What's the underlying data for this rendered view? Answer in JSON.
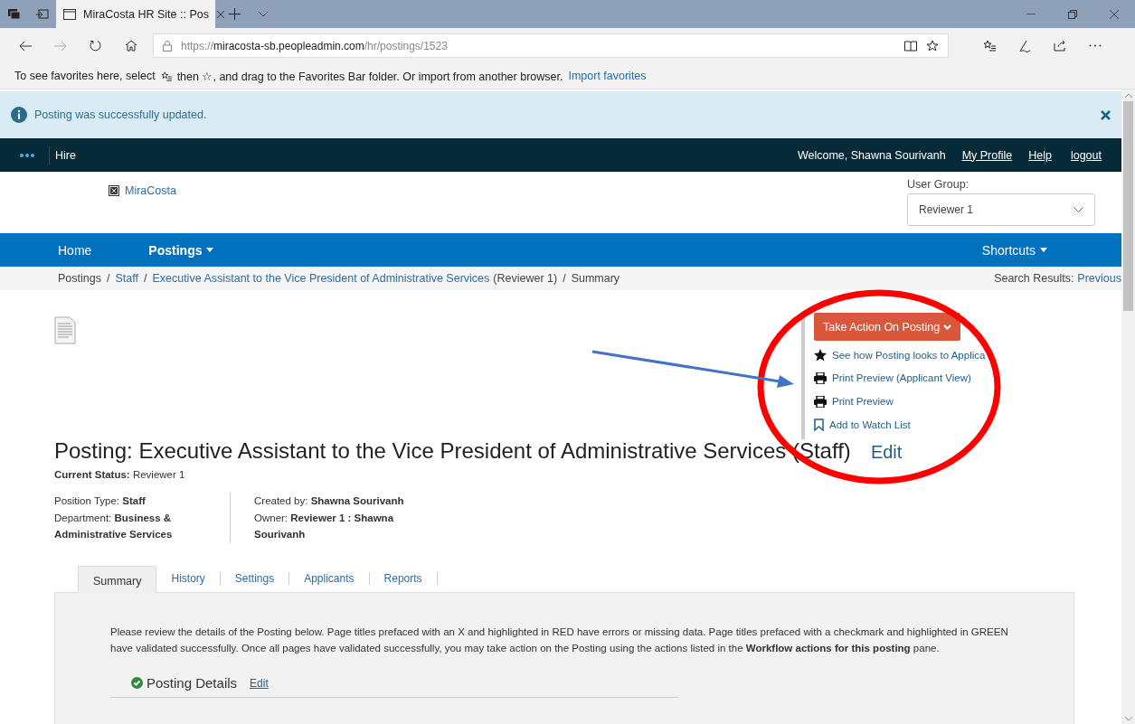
{
  "browser": {
    "tab_title": "MiraCosta HR Site :: Pos",
    "url": {
      "scheme": "https://",
      "host": "miracosta-sb.peopleadmin.com",
      "path": "/hr/postings/1523"
    },
    "favorites_bar": {
      "text_before": "To see favorites here, select",
      "text_after": "then ☆, and drag to the Favorites Bar folder. Or import from another browser.",
      "link": "Import favorites"
    }
  },
  "alert": {
    "message": "Posting was successfully updated."
  },
  "top_nav": {
    "app": "Hire",
    "welcome": "Welcome, Shawna Sourivanh",
    "links": [
      "My Profile",
      "Help",
      "logout"
    ]
  },
  "header": {
    "logo_text": "MiraCosta",
    "user_group": {
      "label": "User Group:",
      "value": "Reviewer 1"
    }
  },
  "main_nav": {
    "items": [
      {
        "label": "Home",
        "dropdown": false
      },
      {
        "label": "Postings",
        "dropdown": true
      }
    ],
    "shortcuts": {
      "label": "Shortcuts",
      "dropdown": true
    }
  },
  "breadcrumb": {
    "separator": "/",
    "items": [
      {
        "label": "Postings",
        "link": false
      },
      {
        "label": "Staff",
        "link": true
      },
      {
        "label": "Executive Assistant to the Vice President of Administrative Services",
        "link": true,
        "note": "(Reviewer 1)"
      },
      {
        "label": "Summary",
        "link": false
      }
    ],
    "search_results": {
      "label": "Search Results:",
      "link": "Previous"
    }
  },
  "actions": {
    "button": "Take Action On Posting",
    "links": [
      {
        "kind": "star",
        "label": "See how Posting looks to Applica"
      },
      {
        "kind": "printer",
        "label": "Print Preview (Applicant View)"
      },
      {
        "kind": "printer",
        "label": "Print Preview"
      },
      {
        "kind": "bookmark",
        "label": "Add to Watch List"
      }
    ]
  },
  "posting": {
    "title": "Posting: Executive Assistant to the Vice President of Administrative Services (Staff)",
    "edit": "Edit",
    "status": {
      "label": "Current Status:",
      "value": "Reviewer 1"
    },
    "details_left": [
      {
        "label": "Position Type:",
        "value": "Staff"
      },
      {
        "label": "Department:",
        "value": "Business & Administrative Services"
      }
    ],
    "details_right": [
      {
        "label": "Created by:",
        "value": "Shawna Sourivanh"
      },
      {
        "label": "Owner:",
        "value": "Reviewer 1 : Shawna Sourivanh"
      }
    ]
  },
  "tabs": [
    {
      "label": "Summary",
      "selected": true
    },
    {
      "label": "History",
      "selected": false
    },
    {
      "label": "Settings",
      "selected": false
    },
    {
      "label": "Applicants",
      "selected": false
    },
    {
      "label": "Reports",
      "selected": false
    }
  ],
  "summary": {
    "instructions": "Please review the details of the Posting below.  Page titles prefaced with an X and highlighted in RED have errors or missing data.  Page titles prefaced with a checkmark and highlighted in GREEN have validated successfully.  Once all pages have validated successfully, you may take action on the Posting using the actions listed in the **Workflow actions for this posting** pane.",
    "section": {
      "title": "Posting Details",
      "edit": "Edit",
      "validated": true
    }
  }
}
